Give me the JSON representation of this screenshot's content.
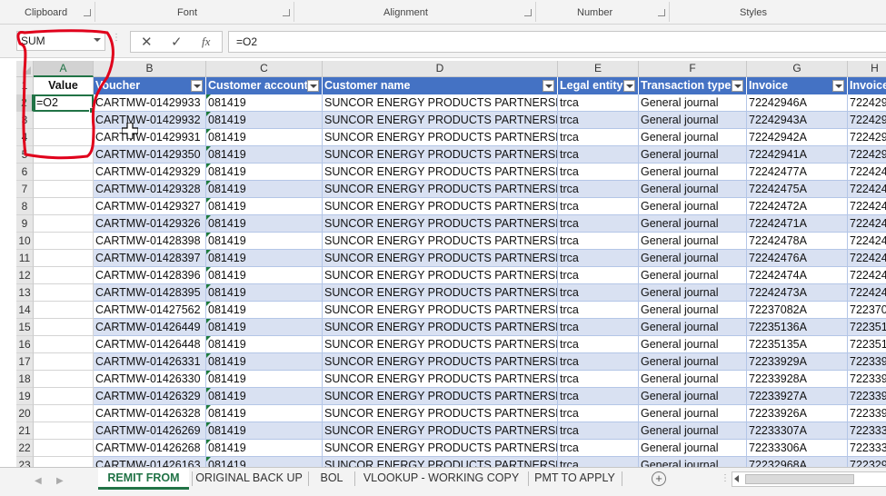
{
  "ribbon": {
    "groups": [
      "Clipboard",
      "Font",
      "Alignment",
      "Number",
      "Styles"
    ]
  },
  "formula_bar": {
    "name_box": "SUM",
    "cancel_icon": "✕",
    "enter_icon": "✓",
    "fx_label": "fx",
    "formula": "=O2"
  },
  "sheet": {
    "columns": [
      "A",
      "B",
      "C",
      "D",
      "E",
      "F",
      "G",
      "H"
    ],
    "value_header": "Value",
    "headers": [
      "Voucher",
      "Customer account",
      "Customer name",
      "Legal entity",
      "Transaction type",
      "Invoice",
      "Invoice"
    ],
    "active_cell_text": "=O2",
    "rows": [
      {
        "n": "1"
      },
      {
        "n": "2",
        "voucher": "CARTMW-01429933",
        "acct": "081419",
        "name": "SUNCOR ENERGY PRODUCTS PARTNERSHIP",
        "entity": "trca",
        "type": "General journal",
        "invoice": "72242946A",
        "invoice2": "722429"
      },
      {
        "n": "3",
        "voucher": "CARTMW-01429932",
        "acct": "081419",
        "name": "SUNCOR ENERGY PRODUCTS PARTNERSHIP",
        "entity": "trca",
        "type": "General journal",
        "invoice": "72242943A",
        "invoice2": "722429"
      },
      {
        "n": "4",
        "voucher": "CARTMW-01429931",
        "acct": "081419",
        "name": "SUNCOR ENERGY PRODUCTS PARTNERSHIP",
        "entity": "trca",
        "type": "General journal",
        "invoice": "72242942A",
        "invoice2": "722429"
      },
      {
        "n": "5",
        "voucher": "CARTMW-01429350",
        "acct": "081419",
        "name": "SUNCOR ENERGY PRODUCTS PARTNERSHIP",
        "entity": "trca",
        "type": "General journal",
        "invoice": "72242941A",
        "invoice2": "722429"
      },
      {
        "n": "6",
        "voucher": "CARTMW-01429329",
        "acct": "081419",
        "name": "SUNCOR ENERGY PRODUCTS PARTNERSHIP",
        "entity": "trca",
        "type": "General journal",
        "invoice": "72242477A",
        "invoice2": "722424"
      },
      {
        "n": "7",
        "voucher": "CARTMW-01429328",
        "acct": "081419",
        "name": "SUNCOR ENERGY PRODUCTS PARTNERSHIP",
        "entity": "trca",
        "type": "General journal",
        "invoice": "72242475A",
        "invoice2": "722424"
      },
      {
        "n": "8",
        "voucher": "CARTMW-01429327",
        "acct": "081419",
        "name": "SUNCOR ENERGY PRODUCTS PARTNERSHIP",
        "entity": "trca",
        "type": "General journal",
        "invoice": "72242472A",
        "invoice2": "722424"
      },
      {
        "n": "9",
        "voucher": "CARTMW-01429326",
        "acct": "081419",
        "name": "SUNCOR ENERGY PRODUCTS PARTNERSHIP",
        "entity": "trca",
        "type": "General journal",
        "invoice": "72242471A",
        "invoice2": "722424"
      },
      {
        "n": "10",
        "voucher": "CARTMW-01428398",
        "acct": "081419",
        "name": "SUNCOR ENERGY PRODUCTS PARTNERSHIP",
        "entity": "trca",
        "type": "General journal",
        "invoice": "72242478A",
        "invoice2": "722424"
      },
      {
        "n": "11",
        "voucher": "CARTMW-01428397",
        "acct": "081419",
        "name": "SUNCOR ENERGY PRODUCTS PARTNERSHIP",
        "entity": "trca",
        "type": "General journal",
        "invoice": "72242476A",
        "invoice2": "722424"
      },
      {
        "n": "12",
        "voucher": "CARTMW-01428396",
        "acct": "081419",
        "name": "SUNCOR ENERGY PRODUCTS PARTNERSHIP",
        "entity": "trca",
        "type": "General journal",
        "invoice": "72242474A",
        "invoice2": "722424"
      },
      {
        "n": "13",
        "voucher": "CARTMW-01428395",
        "acct": "081419",
        "name": "SUNCOR ENERGY PRODUCTS PARTNERSHIP",
        "entity": "trca",
        "type": "General journal",
        "invoice": "72242473A",
        "invoice2": "722424"
      },
      {
        "n": "14",
        "voucher": "CARTMW-01427562",
        "acct": "081419",
        "name": "SUNCOR ENERGY PRODUCTS PARTNERSHIP",
        "entity": "trca",
        "type": "General journal",
        "invoice": "72237082A",
        "invoice2": "722370"
      },
      {
        "n": "15",
        "voucher": "CARTMW-01426449",
        "acct": "081419",
        "name": "SUNCOR ENERGY PRODUCTS PARTNERSHIP",
        "entity": "trca",
        "type": "General journal",
        "invoice": "72235136A",
        "invoice2": "722351"
      },
      {
        "n": "16",
        "voucher": "CARTMW-01426448",
        "acct": "081419",
        "name": "SUNCOR ENERGY PRODUCTS PARTNERSHIP",
        "entity": "trca",
        "type": "General journal",
        "invoice": "72235135A",
        "invoice2": "722351"
      },
      {
        "n": "17",
        "voucher": "CARTMW-01426331",
        "acct": "081419",
        "name": "SUNCOR ENERGY PRODUCTS PARTNERSHIP",
        "entity": "trca",
        "type": "General journal",
        "invoice": "72233929A",
        "invoice2": "722339"
      },
      {
        "n": "18",
        "voucher": "CARTMW-01426330",
        "acct": "081419",
        "name": "SUNCOR ENERGY PRODUCTS PARTNERSHIP",
        "entity": "trca",
        "type": "General journal",
        "invoice": "72233928A",
        "invoice2": "722339"
      },
      {
        "n": "19",
        "voucher": "CARTMW-01426329",
        "acct": "081419",
        "name": "SUNCOR ENERGY PRODUCTS PARTNERSHIP",
        "entity": "trca",
        "type": "General journal",
        "invoice": "72233927A",
        "invoice2": "722339"
      },
      {
        "n": "20",
        "voucher": "CARTMW-01426328",
        "acct": "081419",
        "name": "SUNCOR ENERGY PRODUCTS PARTNERSHIP",
        "entity": "trca",
        "type": "General journal",
        "invoice": "72233926A",
        "invoice2": "722339"
      },
      {
        "n": "21",
        "voucher": "CARTMW-01426269",
        "acct": "081419",
        "name": "SUNCOR ENERGY PRODUCTS PARTNERSHIP",
        "entity": "trca",
        "type": "General journal",
        "invoice": "72233307A",
        "invoice2": "722333"
      },
      {
        "n": "22",
        "voucher": "CARTMW-01426268",
        "acct": "081419",
        "name": "SUNCOR ENERGY PRODUCTS PARTNERSHIP",
        "entity": "trca",
        "type": "General journal",
        "invoice": "72233306A",
        "invoice2": "722333"
      },
      {
        "n": "23",
        "voucher": "CARTMW-01426163",
        "acct": "081419",
        "name": "SUNCOR ENERGY PRODUCTS PARTNERSHIP",
        "entity": "trca",
        "type": "General journal",
        "invoice": "72232968A",
        "invoice2": "722329"
      }
    ]
  },
  "tabs": [
    "REMIT FROM",
    "ORIGINAL BACK UP",
    "BOL",
    "VLOOKUP - WORKING COPY",
    "PMT TO APPLY"
  ],
  "active_tab": "REMIT FROM",
  "colors": {
    "accent": "#217346",
    "table_header": "#4472c4",
    "band": "#d9e1f2",
    "annotation": "#e0001b"
  }
}
